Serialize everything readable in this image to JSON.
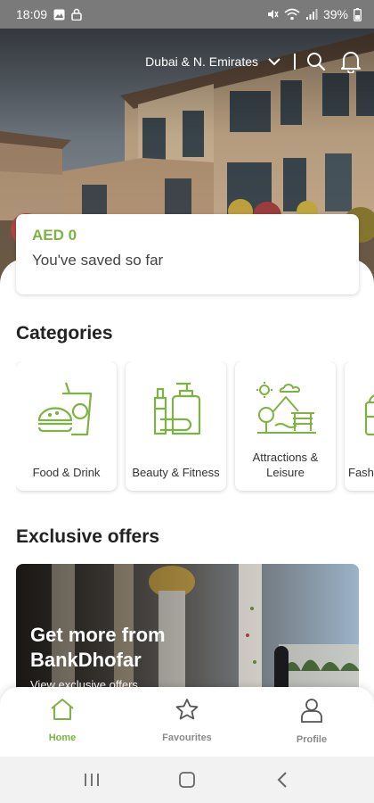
{
  "status_bar": {
    "time": "18:09",
    "battery": "39%",
    "icons": [
      "gallery-icon",
      "lock-icon",
      "mute-icon",
      "wifi-icon",
      "signal-icon",
      "battery-icon"
    ]
  },
  "header": {
    "location": "Dubai & N. Emirates",
    "icons": [
      "chevron-down-icon",
      "search-icon",
      "bell-icon"
    ]
  },
  "savings": {
    "amount": "AED 0",
    "label": "You've saved so far"
  },
  "categories": {
    "title": "Categories",
    "items": [
      {
        "label": "Food & Drink",
        "icon": "food-drink-icon"
      },
      {
        "label": "Beauty & Fitness",
        "icon": "beauty-fitness-icon"
      },
      {
        "label": "Attractions & Leisure",
        "icon": "attractions-icon"
      },
      {
        "label": "Fash",
        "icon": "fashion-icon"
      }
    ]
  },
  "offers": {
    "title": "Exclusive offers",
    "banner_title": "Get more from BankDhofar",
    "banner_subtitle": "View exclusive offers"
  },
  "bottom_nav": {
    "items": [
      {
        "label": "Home",
        "icon": "home-icon",
        "active": true
      },
      {
        "label": "Favourites",
        "icon": "star-icon",
        "active": false
      },
      {
        "label": "Profile",
        "icon": "profile-icon",
        "active": false
      }
    ]
  },
  "colors": {
    "accent": "#7cb342",
    "status_bar": "#7a7a7a",
    "nav_inactive": "#8a8a8a"
  }
}
